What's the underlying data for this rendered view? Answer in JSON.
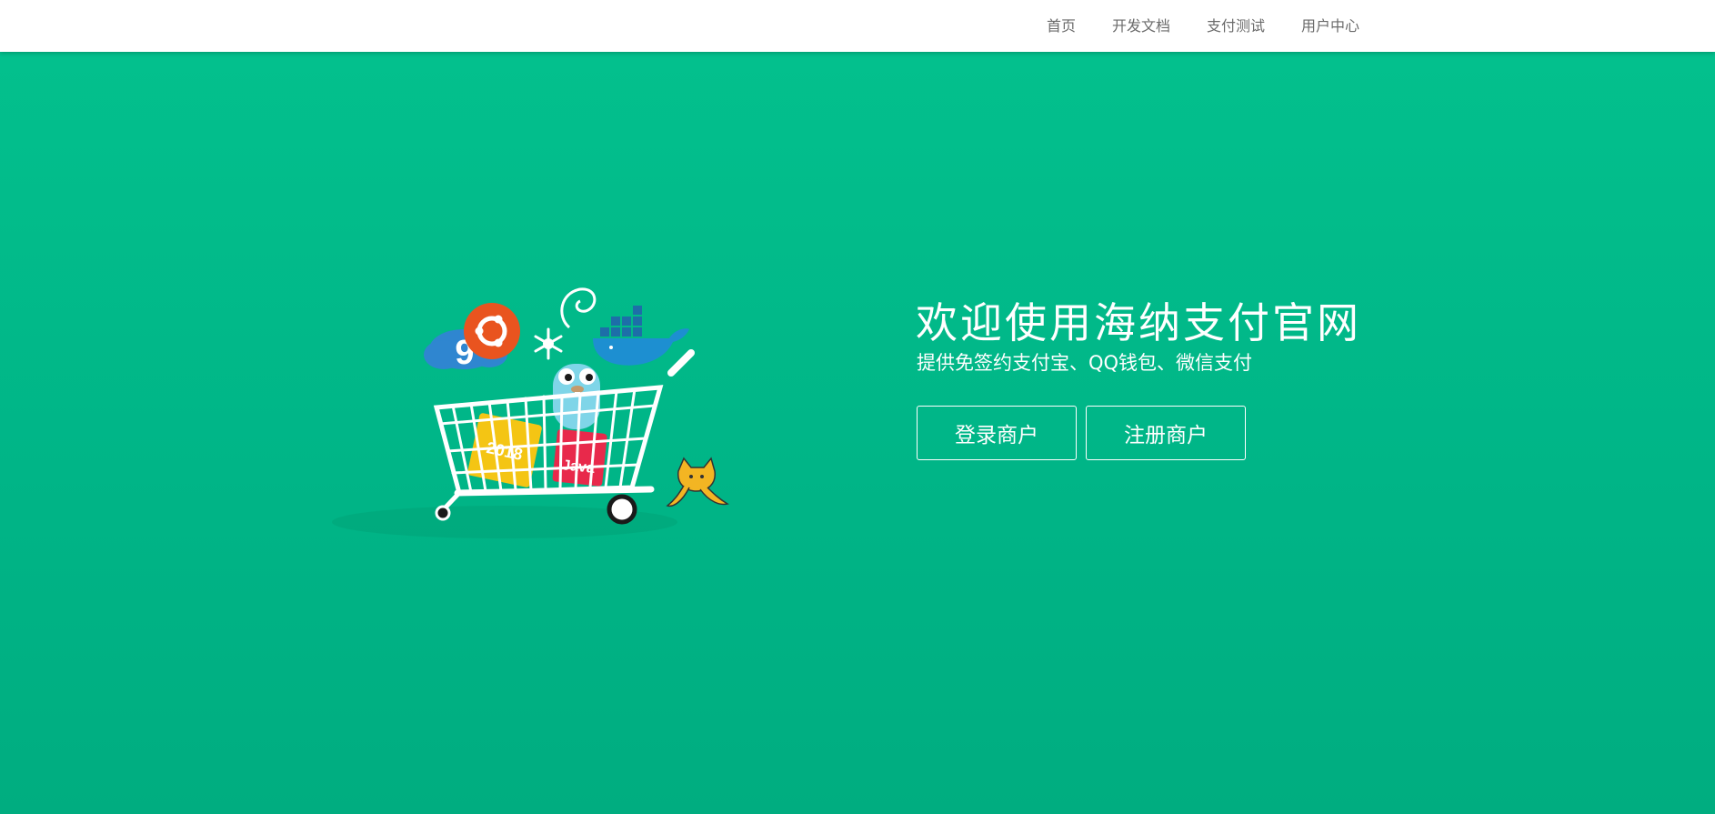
{
  "nav": {
    "items": [
      {
        "label": "首页"
      },
      {
        "label": "开发文档"
      },
      {
        "label": "支付测试"
      },
      {
        "label": "用户中心"
      }
    ]
  },
  "hero": {
    "title": "欢迎使用海纳支付官网",
    "subtitle": "提供免签约支付宝、QQ钱包、微信支付",
    "login_label": "登录商户",
    "register_label": "注册商户",
    "illustration_text": {
      "badge_yellow": "2018",
      "badge_red": "Java",
      "cloud_number": "9"
    }
  },
  "colors": {
    "hero_bg": "#00b98a",
    "nav_text": "#6b6b6b",
    "ubuntu": "#e9541f",
    "docker": "#1d8fd1",
    "gopher": "#7fd5e8",
    "java": "#e8294b",
    "yellow_badge": "#f4c514",
    "tomcat": "#f3b523"
  },
  "icons": [
    "shopping-cart-icon",
    "ubuntu-icon",
    "snowflake-icon",
    "debian-swirl-icon",
    "docker-whale-icon",
    "gopher-icon",
    "cloud-icon",
    "java-badge-icon",
    "tomcat-cat-icon"
  ]
}
